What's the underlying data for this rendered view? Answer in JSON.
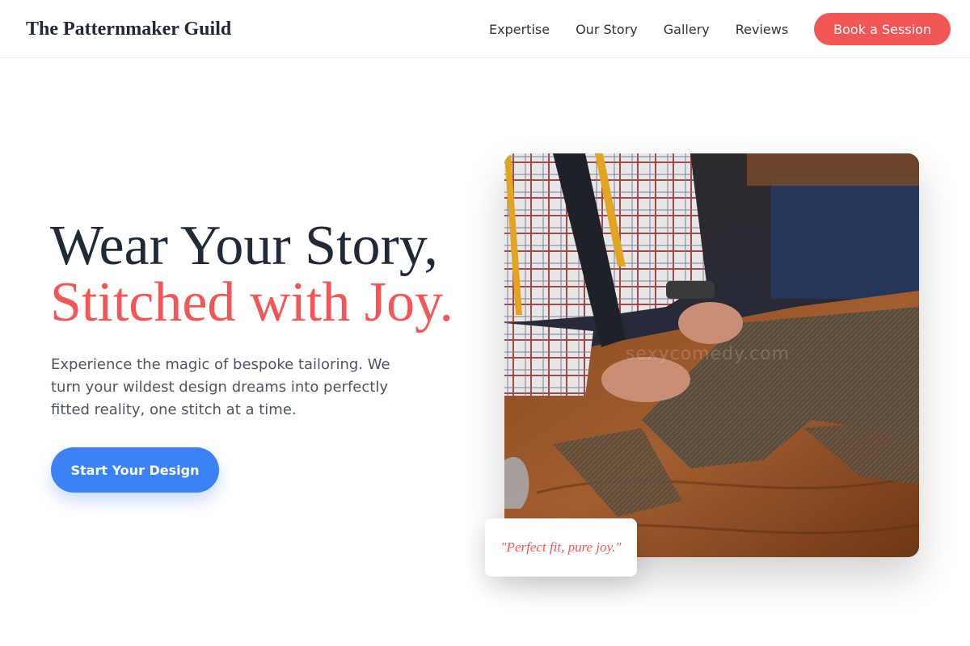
{
  "header": {
    "brand": "The Patternmaker Guild",
    "nav": [
      {
        "label": "Expertise"
      },
      {
        "label": "Our Story"
      },
      {
        "label": "Gallery"
      },
      {
        "label": "Reviews"
      }
    ],
    "cta_label": "Book a Session"
  },
  "hero": {
    "title_line1": "Wear Your Story,",
    "title_line2": "Stitched with Joy.",
    "description": "Experience the magic of bespoke tailoring. We turn your wildest design dreams into perfectly fitted reality, one stitch at a time.",
    "cta_label": "Start Your Design",
    "image_watermark": "sexycomedy.com",
    "quote": "\"Perfect fit, pure joy.\""
  },
  "colors": {
    "accent": "#f25757",
    "primary_button": "#3b82f6",
    "heading": "#1f2937",
    "body_text": "#4b5563"
  },
  "icons": {
    "hero_image": "tailor-cutting-fabric-photo"
  }
}
